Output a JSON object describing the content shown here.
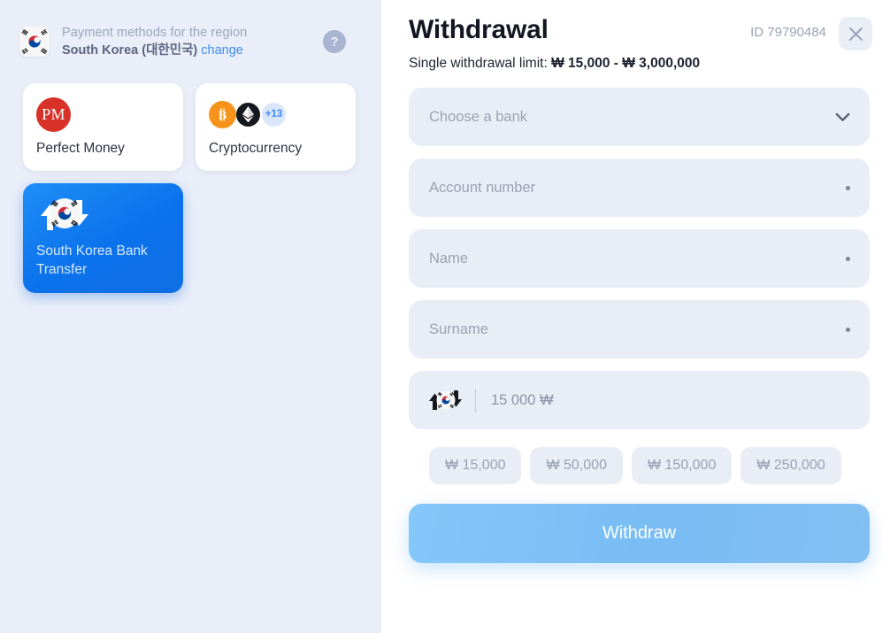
{
  "region_header": {
    "caption": "Payment methods for the region",
    "country": "South Korea",
    "country_native": "(대한민국)",
    "change_label": "change",
    "help_icon": "question-mark-icon",
    "flag_icon": "south-korea-flag-icon"
  },
  "methods": [
    {
      "label": "Perfect Money",
      "logo": "perfect-money-logo",
      "logo_text": "PM",
      "selected": false
    },
    {
      "label": "Cryptocurrency",
      "logos": [
        "bitcoin-icon",
        "ethereum-icon"
      ],
      "bitcoin_glyph": "₿",
      "more_badge": "+13",
      "selected": false
    },
    {
      "label": "South Korea Bank Transfer",
      "logo": "korea-bank-transfer-icon",
      "selected": true
    }
  ],
  "withdrawal": {
    "title": "Withdrawal",
    "id_label": "ID 79790484",
    "close_icon": "close-icon",
    "limit_prefix": "Single withdrawal limit: ",
    "limit_min": "₩ 15,000",
    "limit_separator": " - ",
    "limit_max": "₩ 3,000,000",
    "fields": [
      {
        "placeholder": "Choose a bank",
        "type": "select",
        "indicator": "chevron-down-icon"
      },
      {
        "placeholder": "Account number",
        "type": "text",
        "indicator": "required-dot"
      },
      {
        "placeholder": "Name",
        "type": "text",
        "indicator": "required-dot"
      },
      {
        "placeholder": "Surname",
        "type": "text",
        "indicator": "required-dot"
      }
    ],
    "amount_field": {
      "icon": "korea-bank-transfer-icon",
      "placeholder": "15 000 ₩"
    },
    "quick_amounts": [
      "₩ 15,000",
      "₩ 50,000",
      "₩ 150,000",
      "₩ 250,000"
    ],
    "submit_label": "Withdraw"
  },
  "colors": {
    "accent_blue": "#0b72ec",
    "link_blue": "#3d8bf5",
    "panel_bg": "#eaeef8",
    "field_bg": "#e9edf6",
    "submit_gradient_start": "#84c7f9",
    "perfect_money_red": "#d8312a",
    "bitcoin_orange": "#f7931a",
    "ethereum_black": "#15181c"
  }
}
